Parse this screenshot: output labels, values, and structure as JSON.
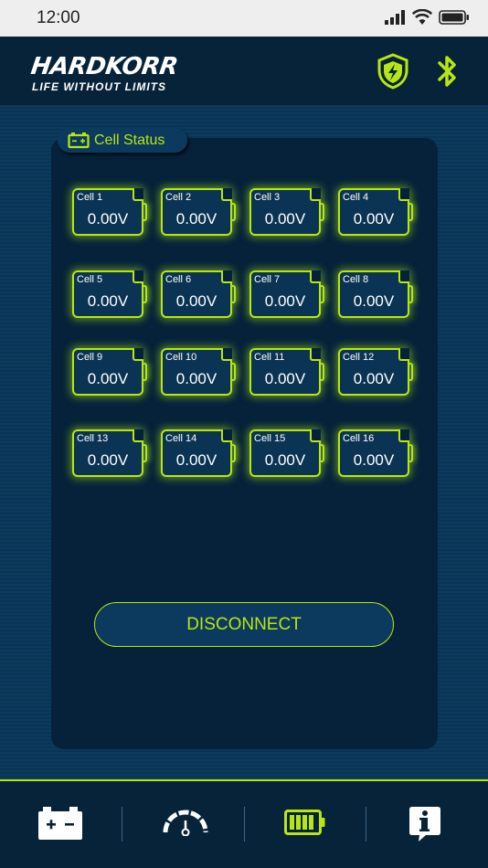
{
  "status_bar": {
    "time": "12:00"
  },
  "header": {
    "logo": "HARDKORR",
    "tagline": "LIFE WITHOUT LIMITS"
  },
  "panel": {
    "title": "Cell Status"
  },
  "cells": [
    {
      "name": "Cell 1",
      "value": "0.00V"
    },
    {
      "name": "Cell 2",
      "value": "0.00V"
    },
    {
      "name": "Cell 3",
      "value": "0.00V"
    },
    {
      "name": "Cell 4",
      "value": "0.00V"
    },
    {
      "name": "Cell 5",
      "value": "0.00V"
    },
    {
      "name": "Cell 6",
      "value": "0.00V"
    },
    {
      "name": "Cell 7",
      "value": "0.00V"
    },
    {
      "name": "Cell 8",
      "value": "0.00V"
    },
    {
      "name": "Cell 9",
      "value": "0.00V"
    },
    {
      "name": "Cell 10",
      "value": "0.00V"
    },
    {
      "name": "Cell 11",
      "value": "0.00V"
    },
    {
      "name": "Cell 12",
      "value": "0.00V"
    },
    {
      "name": "Cell 13",
      "value": "0.00V"
    },
    {
      "name": "Cell 14",
      "value": "0.00V"
    },
    {
      "name": "Cell 15",
      "value": "0.00V"
    },
    {
      "name": "Cell 16",
      "value": "0.00V"
    }
  ],
  "actions": {
    "disconnect_label": "DISCONNECT"
  },
  "bottom_nav": [
    {
      "icon": "car-battery-icon",
      "active": false
    },
    {
      "icon": "gauge-icon",
      "active": false
    },
    {
      "icon": "battery-level-icon",
      "active": true
    },
    {
      "icon": "info-icon",
      "active": false
    }
  ],
  "colors": {
    "accent": "#b8e613",
    "header_bg": "#062339",
    "panel_bg": "#06223a",
    "main_bg": "#0c3a5e"
  }
}
